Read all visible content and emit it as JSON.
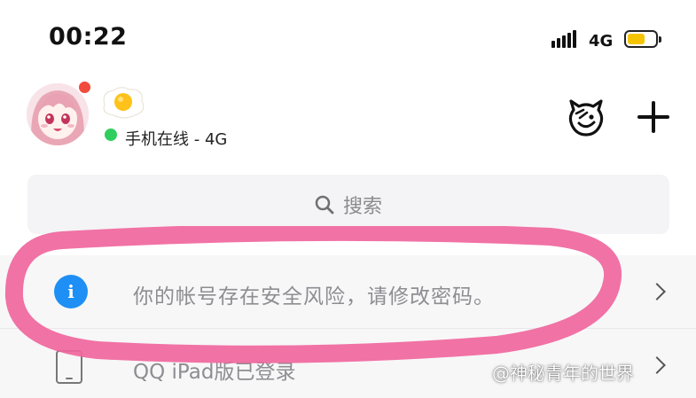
{
  "status_bar": {
    "time": "00:22",
    "network": "4G",
    "battery_level": 0.62,
    "battery_color": "#f5c400"
  },
  "header": {
    "avatar_icon": "anime-girl-avatar",
    "badge_color": "#f24a3d",
    "status_icon": "fried-egg-icon",
    "online_status": "手机在线 - 4G",
    "online_color": "#2fcf5f",
    "actions": [
      {
        "icon": "mascot-icon"
      },
      {
        "icon": "plus-icon"
      }
    ]
  },
  "search": {
    "placeholder": "搜索",
    "icon": "search-icon"
  },
  "notices": [
    {
      "icon": "info-icon",
      "icon_text": "i",
      "text": "你的帐号存在安全风险，请修改密码。",
      "accent": "#1e8ff5"
    },
    {
      "icon": "ipad-icon",
      "text": "QQ iPad版已登录"
    }
  ],
  "annotation": {
    "highlight_color": "#f0669d"
  },
  "watermark": "@神秘青年的世界"
}
